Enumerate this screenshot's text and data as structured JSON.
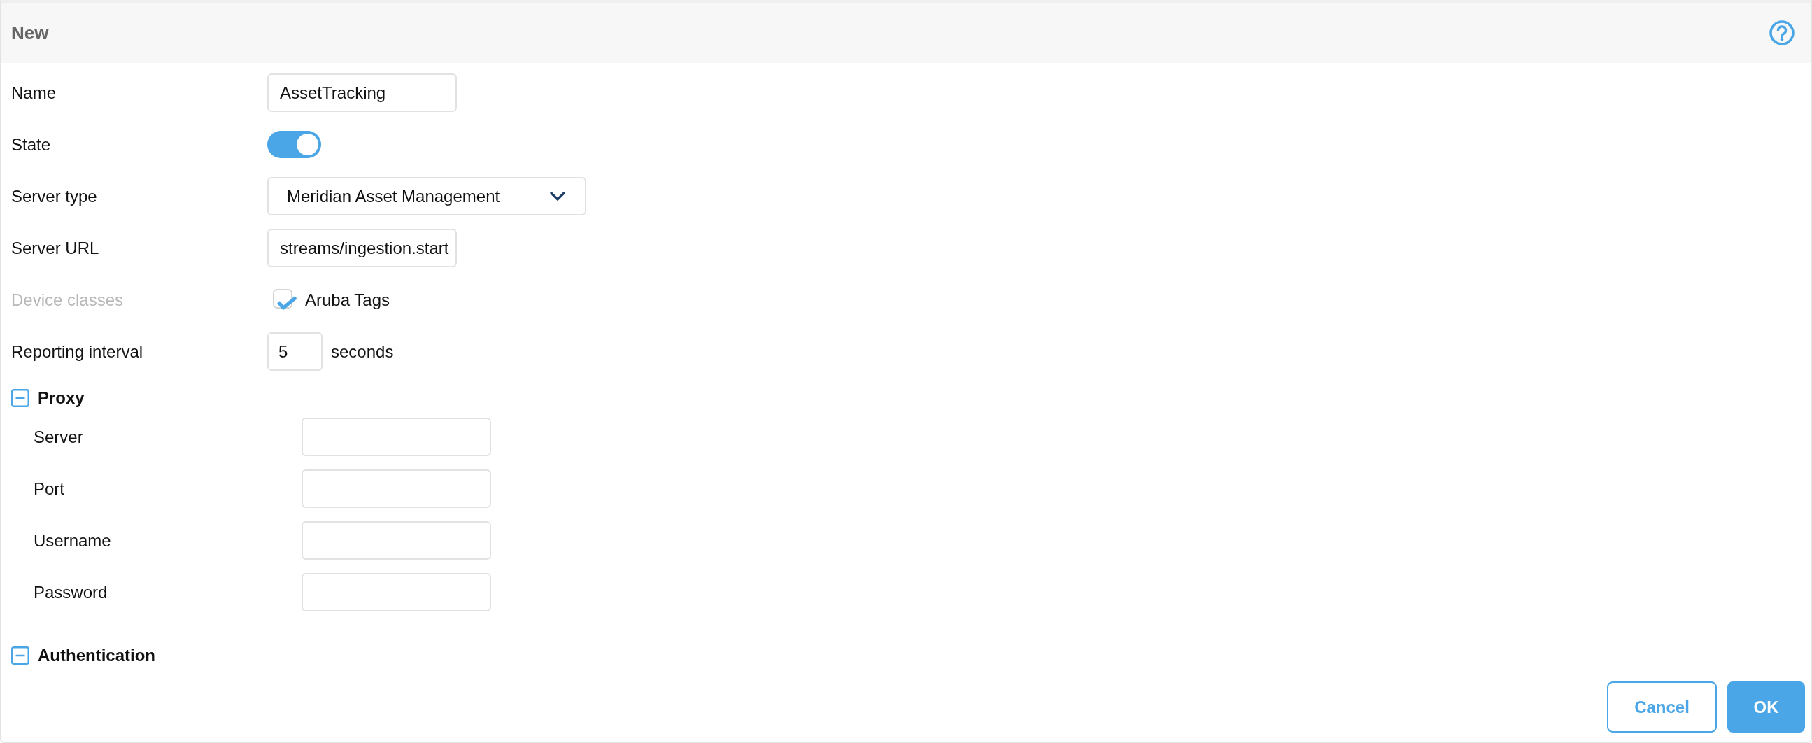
{
  "dialog": {
    "title": "New"
  },
  "fields": [
    {
      "kind": "text",
      "label": "Name",
      "value": "AssetTracking",
      "disabled": false
    },
    {
      "kind": "toggle",
      "label": "State",
      "on": true,
      "disabled": false
    },
    {
      "kind": "select",
      "label": "Server type",
      "value": "Meridian Asset Management",
      "disabled": false
    },
    {
      "kind": "text",
      "label": "Server URL",
      "value": "streams/ingestion.start",
      "disabled": false
    },
    {
      "kind": "checkbox",
      "label": "Device classes",
      "option": "Aruba Tags",
      "checked": true,
      "disabled": true
    },
    {
      "kind": "number",
      "label": "Reporting interval",
      "value": "5",
      "unit": "seconds",
      "disabled": false
    }
  ],
  "sections": [
    {
      "title": "Proxy",
      "expanded": true,
      "fields": [
        {
          "label": "Server"
        },
        {
          "label": "Port"
        },
        {
          "label": "Username"
        },
        {
          "label": "Password"
        }
      ]
    },
    {
      "title": "Authentication",
      "expanded": true
    }
  ],
  "buttons": [
    {
      "label": "Cancel",
      "kind": "secondary"
    },
    {
      "label": "OK",
      "kind": "primary"
    }
  ]
}
